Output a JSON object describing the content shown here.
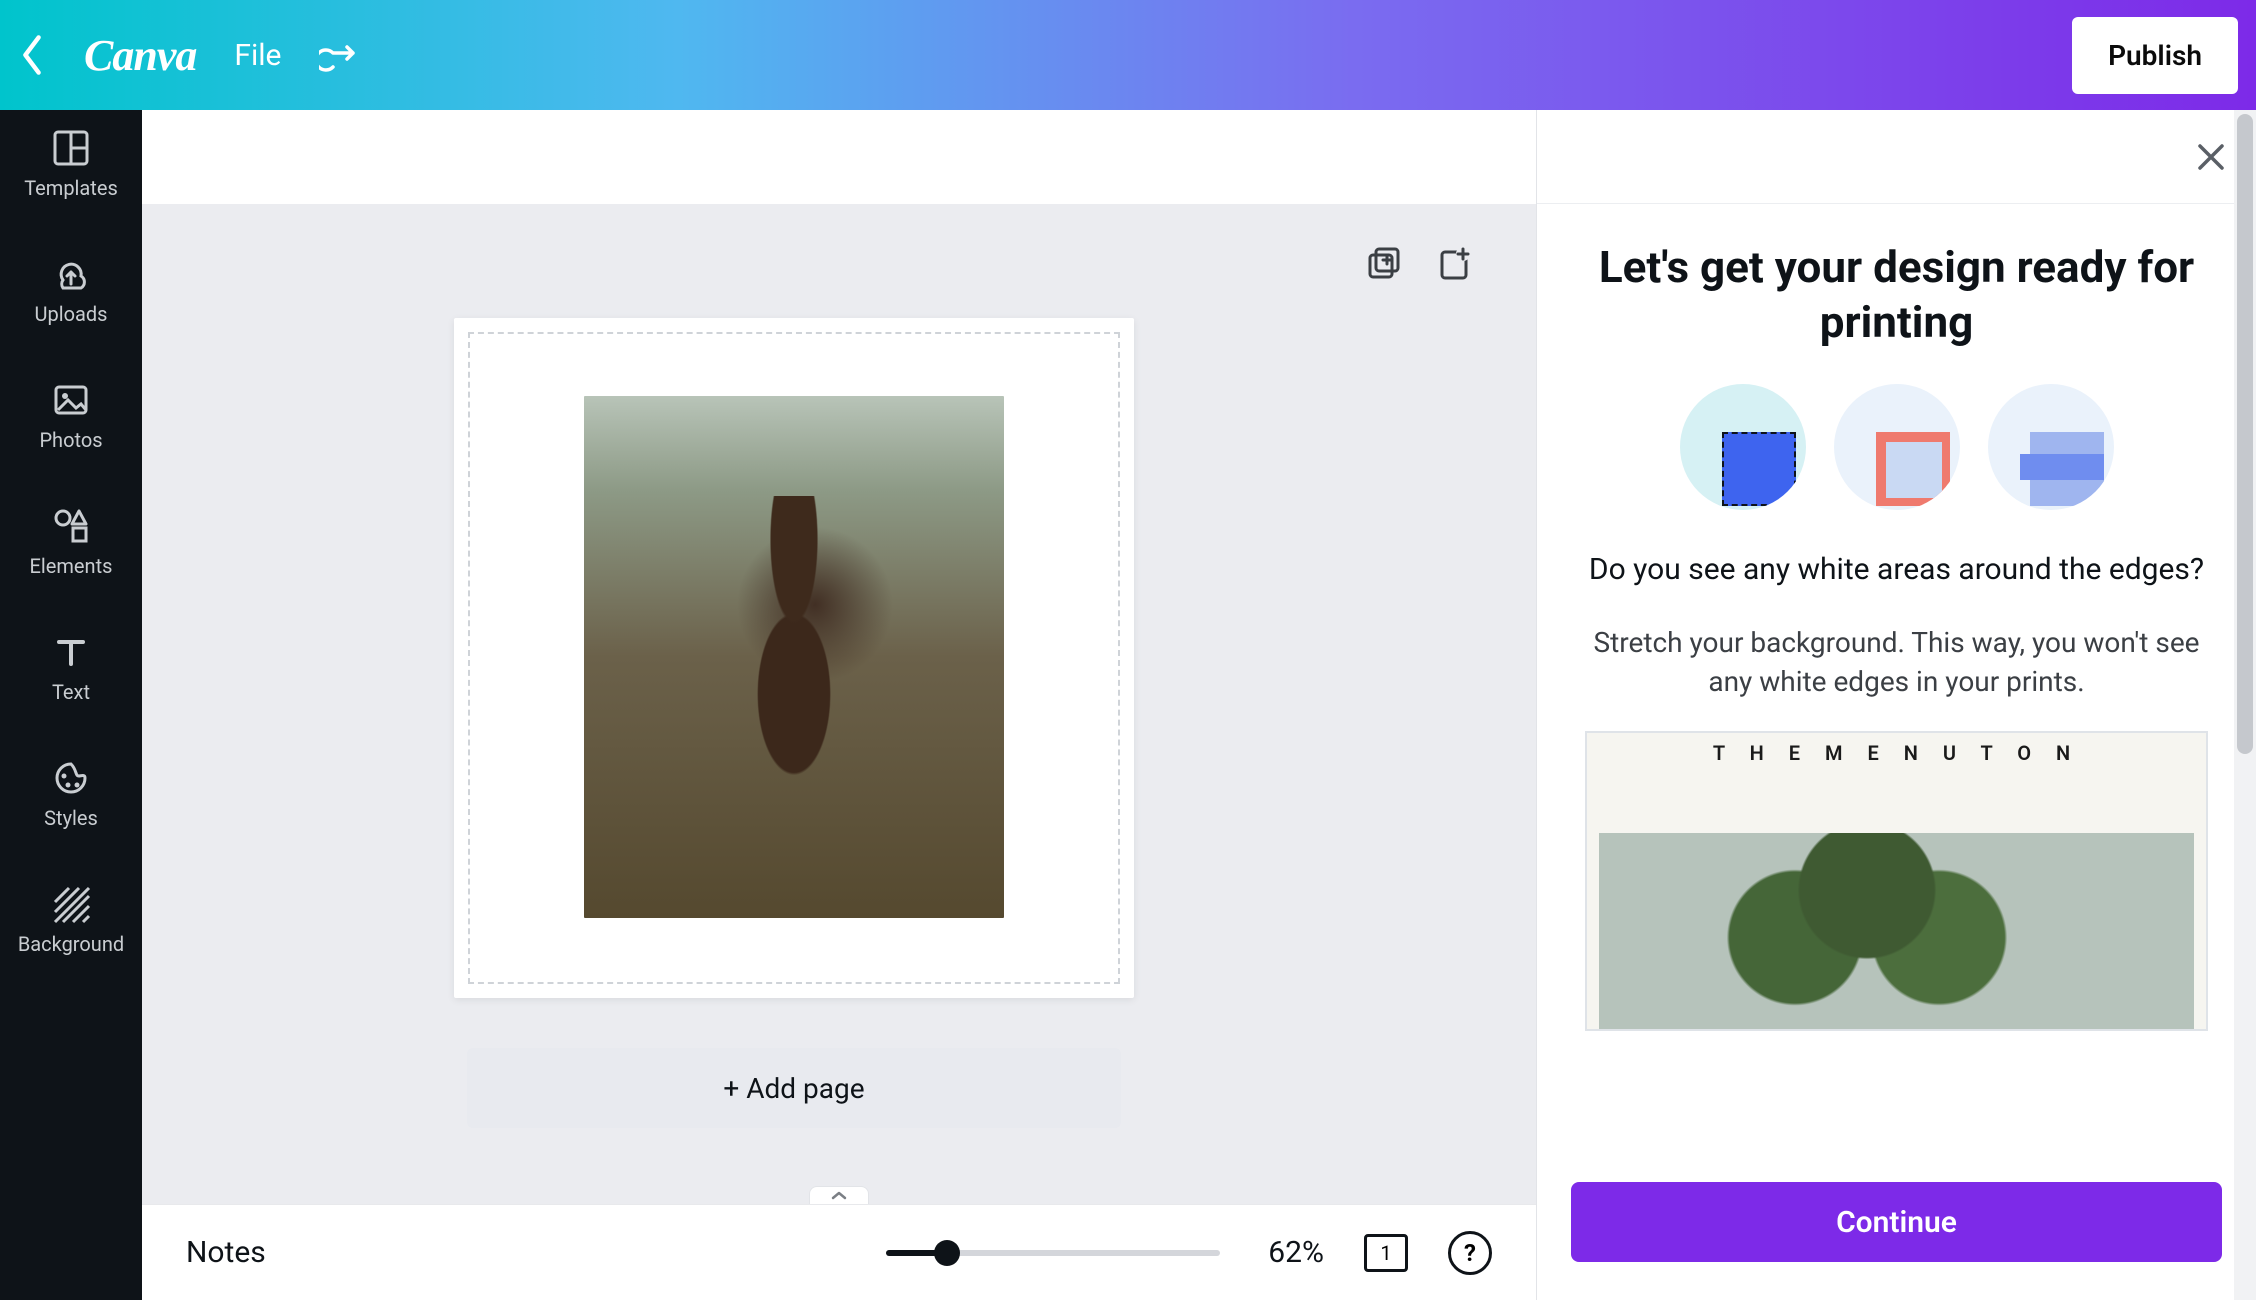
{
  "topbar": {
    "logo_text": "Canva",
    "file_label": "File",
    "publish_label": "Publish"
  },
  "sidebar": {
    "items": [
      {
        "label": "Templates"
      },
      {
        "label": "Uploads"
      },
      {
        "label": "Photos"
      },
      {
        "label": "Elements"
      },
      {
        "label": "Text"
      },
      {
        "label": "Styles"
      },
      {
        "label": "Background"
      }
    ]
  },
  "canvas": {
    "add_page_label": "+ Add page"
  },
  "footer": {
    "notes_label": "Notes",
    "zoom_label": "62%",
    "page_count": "1"
  },
  "right_panel": {
    "title": "Let's get your design ready for printing",
    "question": "Do you see any white areas around the edges?",
    "description": "Stretch your background. This way, you won't see any white edges in your prints.",
    "example_caption": "T H E M E N U T O N",
    "continue_label": "Continue"
  }
}
